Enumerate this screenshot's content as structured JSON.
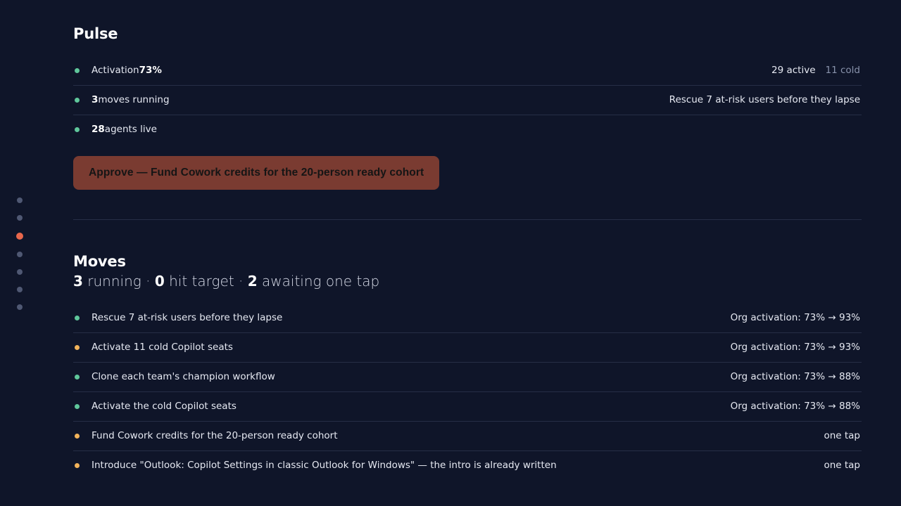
{
  "nav_dots": {
    "count": 7,
    "active_index": 2
  },
  "pulse": {
    "title": "Pulse",
    "rows": [
      {
        "status": "green",
        "label": "Activation ",
        "value": "73%",
        "right": "29 active",
        "right_muted": "11 cold"
      },
      {
        "status": "green",
        "value": "3",
        "label": " moves running",
        "right": "Rescue 7 at-risk users before they lapse"
      },
      {
        "status": "green",
        "value": "28",
        "label": " agents live"
      }
    ],
    "approve_label": "Approve — Fund Cowork credits for the 20-person ready cohort"
  },
  "moves": {
    "title": "Moves",
    "summary": {
      "running_count": "3",
      "running_label": " running · ",
      "hit_count": "0",
      "hit_label": " hit target · ",
      "awaiting_count": "2",
      "awaiting_label": " awaiting one tap"
    },
    "rows": [
      {
        "status": "green",
        "label": "Rescue 7 at-risk users before they lapse",
        "right": "Org activation: 73% → 93%"
      },
      {
        "status": "amber",
        "label": "Activate 11 cold Copilot seats",
        "right": "Org activation: 73% → 93%"
      },
      {
        "status": "green",
        "label": "Clone each team's champion workflow",
        "right": "Org activation: 73% → 88%"
      },
      {
        "status": "green",
        "label": "Activate the cold Copilot seats",
        "right": "Org activation: 73% → 88%"
      },
      {
        "status": "amber",
        "label": "Fund Cowork credits for the 20-person ready cohort",
        "right": "one tap"
      },
      {
        "status": "amber",
        "label": "Introduce \"Outlook: Copilot Settings in classic Outlook for Windows\" — the intro is already written",
        "right": "one tap"
      }
    ]
  },
  "colors": {
    "background": "#0f1529",
    "accent": "#e8674c",
    "status_green": "#5fc79b",
    "status_amber": "#f2b35a",
    "approve_bg": "#7a3b31"
  }
}
